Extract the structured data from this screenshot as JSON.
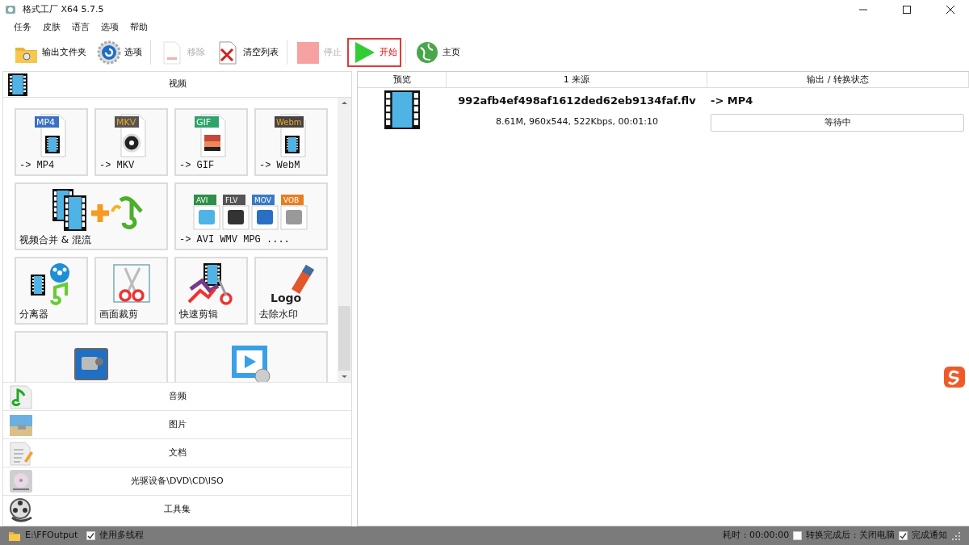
{
  "window": {
    "title": "格式工厂 X64 5.7.5"
  },
  "menu": [
    "任务",
    "皮肤",
    "语言",
    "选项",
    "帮助"
  ],
  "toolbar": [
    {
      "kind": "folder",
      "label": "输出文件夹",
      "disabled": false,
      "highlighted": false
    },
    {
      "kind": "gear",
      "label": "选项",
      "disabled": false,
      "highlighted": false
    },
    {
      "kind": "remove",
      "label": "移除",
      "disabled": true,
      "highlighted": false
    },
    {
      "kind": "clear",
      "label": "清空列表",
      "disabled": false,
      "highlighted": false
    },
    {
      "kind": "stop",
      "label": "停止",
      "disabled": true,
      "highlighted": false
    },
    {
      "kind": "start",
      "label": "开始",
      "disabled": false,
      "highlighted": true
    },
    {
      "kind": "home",
      "label": "主页",
      "disabled": false,
      "highlighted": false
    }
  ],
  "video_section": {
    "title": "视频",
    "tiles": [
      {
        "kind": "format",
        "badge": "MP4",
        "color": "#3a6fc4",
        "label": "-> MP4"
      },
      {
        "kind": "format",
        "badge": "MKV",
        "color": "#555555",
        "label": "-> MKV"
      },
      {
        "kind": "format",
        "badge": "GIF",
        "color": "#2fa36b",
        "label": "-> GIF"
      },
      {
        "kind": "format",
        "badge": "Webm",
        "color": "#444444",
        "label": "-> WebM"
      },
      {
        "kind": "merge",
        "label": "视频合并 & 混流"
      },
      {
        "kind": "formats",
        "badges": [
          "AVI",
          "FLV",
          "MOV",
          "VOB"
        ],
        "label": "-> AVI WMV MPG ...."
      },
      {
        "kind": "splitter",
        "label": "分离器"
      },
      {
        "kind": "crop",
        "label": "画面裁剪"
      },
      {
        "kind": "quickcut",
        "label": "快速剪辑"
      },
      {
        "kind": "watermark",
        "logo": "Logo",
        "label": "去除水印"
      },
      {
        "kind": "recorder"
      },
      {
        "kind": "player"
      }
    ]
  },
  "categories": [
    {
      "kind": "audio",
      "label": "音频"
    },
    {
      "kind": "picture",
      "label": "图片"
    },
    {
      "kind": "document",
      "label": "文档"
    },
    {
      "kind": "disc",
      "label": "光驱设备\\DVD\\CD\\ISO"
    },
    {
      "kind": "tools",
      "label": "工具集"
    }
  ],
  "table": {
    "columns": [
      "预览",
      "1 来源",
      "输出 / 转换状态"
    ],
    "rows": [
      {
        "filename": "992afb4ef498af1612ded62eb9134faf.flv",
        "info": "8.61M, 960x544, 522Kbps, 00:01:10",
        "output": "-> MP4",
        "status": "等待中"
      }
    ]
  },
  "status_bar": {
    "output_path": "E:\\FFOutput",
    "multithread": {
      "label": "使用多线程",
      "checked": true
    },
    "elapsed": "耗时 : 00:00:00",
    "shutdown": {
      "label": "转换完成后 : 关闭电脑",
      "checked": false
    },
    "notify": {
      "label": "完成通知",
      "checked": true
    }
  }
}
